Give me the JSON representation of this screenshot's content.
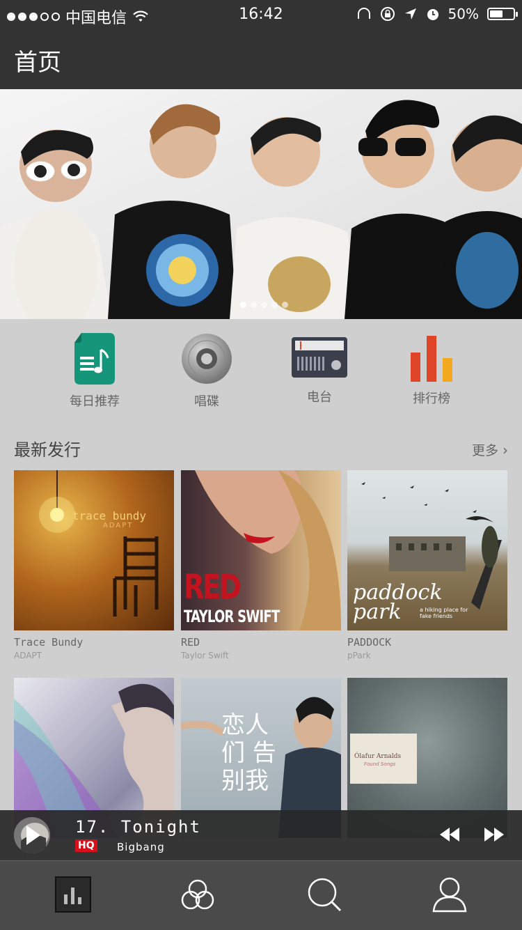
{
  "status": {
    "carrier": "中国电信",
    "time": "16:42",
    "battery": "50%"
  },
  "header": {
    "title": "首页"
  },
  "banner": {
    "page_count": 5,
    "active_index": 0
  },
  "quick": [
    {
      "label": "每日推荐",
      "icon": "daily-music-icon"
    },
    {
      "label": "唱碟",
      "icon": "vinyl-disc-icon"
    },
    {
      "label": "电台",
      "icon": "radio-icon"
    },
    {
      "label": "排行榜",
      "icon": "chart-bars-icon"
    }
  ],
  "latest": {
    "title": "最新发行",
    "more": "更多",
    "albums": [
      {
        "title": "Trace Bundy",
        "artist": "ADAPT",
        "cover_text": "trace bundy",
        "cover_sub": "ADAPT"
      },
      {
        "title": "RED",
        "artist": "Taylor Swift",
        "cover_text": "RED",
        "cover_sub": "TAYLOR SWIFT"
      },
      {
        "title": "PADDOCK",
        "artist": "pPark",
        "cover_text": "paddock park",
        "cover_sub": "a hiking place for fake friends"
      },
      {
        "title": "",
        "artist": "",
        "cover_text": ""
      },
      {
        "title": "",
        "artist": "",
        "cover_text": "恋人们 告别我"
      },
      {
        "title": "",
        "artist": "",
        "cover_text": "Ólafur Arnalds",
        "cover_sub": "Found Songs"
      }
    ]
  },
  "player": {
    "title": "17. Tonight",
    "badge": "HQ",
    "artist": "Bigbang"
  },
  "tabs": [
    {
      "name": "tab-music",
      "icon": "equalizer-icon",
      "active": true
    },
    {
      "name": "tab-discover",
      "icon": "circles-icon"
    },
    {
      "name": "tab-search",
      "icon": "search-icon"
    },
    {
      "name": "tab-profile",
      "icon": "user-icon"
    }
  ],
  "colors": {
    "header_bg": "#333333",
    "page_bg": "#cfcfcf",
    "hq_badge": "#d8101c",
    "daily_icon": "#15967a",
    "chart_red": "#e0452a",
    "chart_yellow": "#f2a91f"
  }
}
